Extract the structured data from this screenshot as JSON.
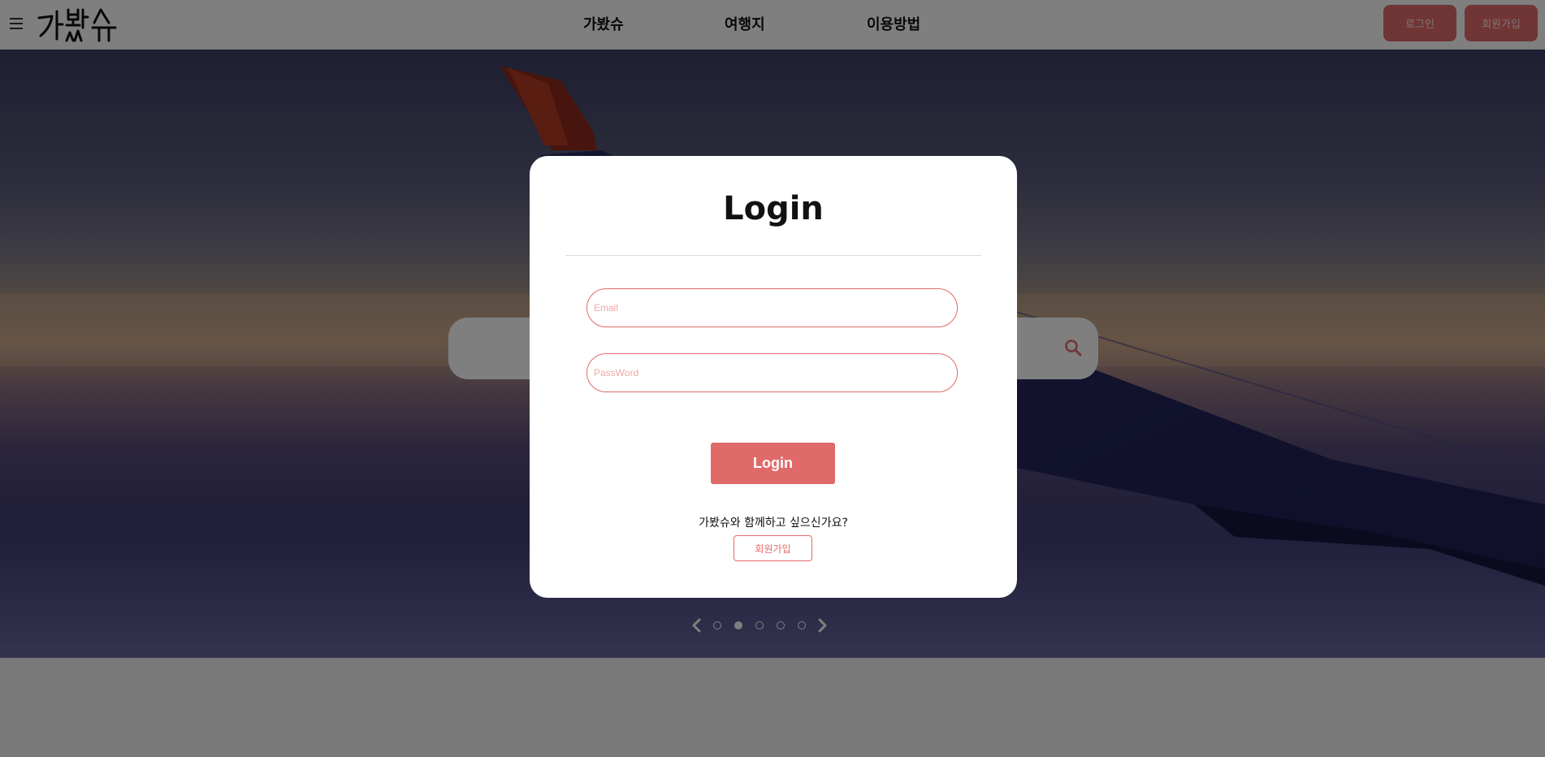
{
  "header": {
    "logo_text": "가봤슈",
    "nav": [
      "가봤슈",
      "여행지",
      "이용방법"
    ],
    "login_label": "로그인",
    "signup_label": "회원가입"
  },
  "hero": {
    "slides_total": 5,
    "active_slide": 2
  },
  "login_modal": {
    "title": "Login",
    "email_placeholder": "Email",
    "password_placeholder": "PassWord",
    "submit_label": "Login",
    "signup_prompt": "가봤슈와 함께하고 싶으신가요?",
    "signup_label": "회원가입"
  },
  "colors": {
    "accent": "#e06a6a"
  }
}
